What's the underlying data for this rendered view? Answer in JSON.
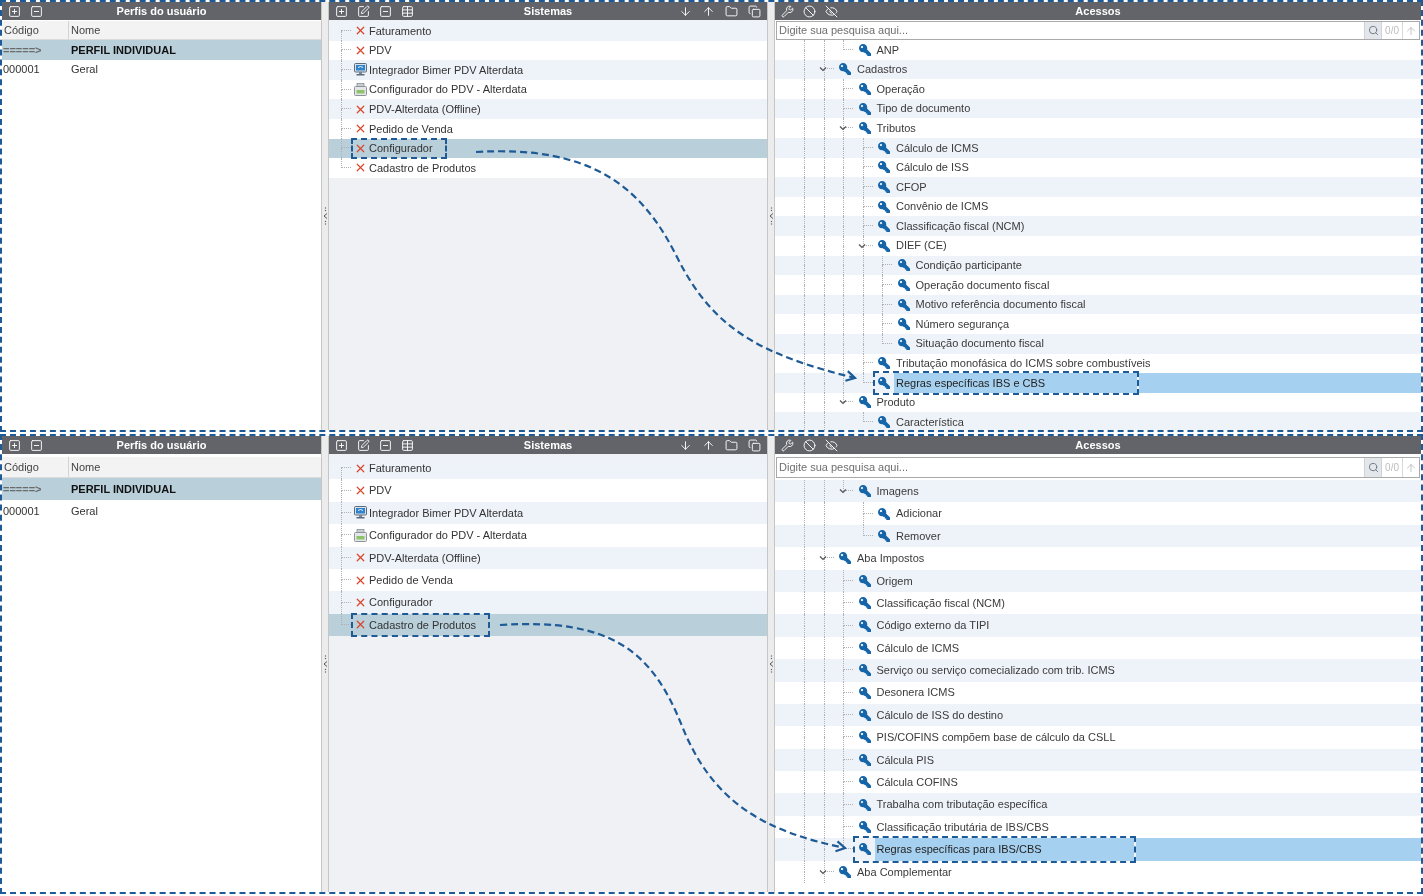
{
  "screens": [
    {
      "profiles": {
        "title": "Perfis do usuário",
        "columns": [
          "Código",
          "Nome"
        ],
        "rows": [
          {
            "code": "=====>",
            "name": "PERFIL INDIVIDUAL",
            "selected": true
          },
          {
            "code": "000001",
            "name": "Geral",
            "selected": false
          }
        ]
      },
      "systems": {
        "title": "Sistemas",
        "items": [
          {
            "label": "Faturamento",
            "kind": "denied",
            "selected": false
          },
          {
            "label": "PDV",
            "kind": "denied",
            "selected": false
          },
          {
            "label": "Integrador Bimer PDV Alterdata",
            "kind": "computer",
            "selected": false
          },
          {
            "label": "Configurador do PDV - Alterdata",
            "kind": "register",
            "selected": false
          },
          {
            "label": "PDV-Alterdata (Offline)",
            "kind": "denied",
            "selected": false
          },
          {
            "label": "Pedido de Venda",
            "kind": "denied",
            "selected": false
          },
          {
            "label": "Configurador",
            "kind": "denied",
            "selected": true
          },
          {
            "label": "Cadastro de Produtos",
            "kind": "denied",
            "selected": false
          }
        ]
      },
      "access": {
        "title": "Acessos",
        "search": {
          "placeholder": "Digite sua pesquisa aqui...",
          "counter": "0/0",
          "navigation_disabled": true
        },
        "tree": [
          {
            "children": [
              {
                "label": "ANP",
                "selected": false
              }
            ]
          },
          {
            "label": "Cadastros",
            "expanded": true,
            "selected": false,
            "children": [
              {
                "label": "Operação",
                "selected": false
              },
              {
                "label": "Tipo de documento",
                "selected": false
              },
              {
                "label": "Tributos",
                "expanded": true,
                "selected": false,
                "children": [
                  {
                    "label": "Cálculo de ICMS",
                    "selected": false
                  },
                  {
                    "label": "Cálculo de ISS",
                    "selected": false
                  },
                  {
                    "label": "CFOP",
                    "selected": false
                  },
                  {
                    "label": "Convênio de ICMS",
                    "selected": false
                  },
                  {
                    "label": "Classificação fiscal (NCM)",
                    "selected": false
                  },
                  {
                    "label": "DIEF (CE)",
                    "expanded": true,
                    "selected": false,
                    "children": [
                      {
                        "label": "Condição participante",
                        "selected": false
                      },
                      {
                        "label": "Operação documento fiscal",
                        "selected": false
                      },
                      {
                        "label": "Motivo referência documento fiscal",
                        "selected": false
                      },
                      {
                        "label": "Número segurança",
                        "selected": false
                      },
                      {
                        "label": "Situação documento fiscal",
                        "selected": false
                      }
                    ]
                  },
                  {
                    "label": "Tributação monofásica do ICMS sobre combustíveis",
                    "selected": false
                  },
                  {
                    "label": "Regras específicas IBS e CBS",
                    "selected": true
                  }
                ]
              },
              {
                "label": "Produto",
                "expanded": true,
                "selected": false,
                "children": [
                  {
                    "label": "Característica",
                    "selected": false
                  }
                ]
              }
            ]
          }
        ]
      }
    },
    {
      "profiles": {
        "title": "Perfis do usuário",
        "columns": [
          "Código",
          "Nome"
        ],
        "rows": [
          {
            "code": "=====>",
            "name": "PERFIL INDIVIDUAL",
            "selected": true
          },
          {
            "code": "000001",
            "name": "Geral",
            "selected": false
          }
        ]
      },
      "systems": {
        "title": "Sistemas",
        "items": [
          {
            "label": "Faturamento",
            "kind": "denied",
            "selected": false
          },
          {
            "label": "PDV",
            "kind": "denied",
            "selected": false
          },
          {
            "label": "Integrador Bimer PDV Alterdata",
            "kind": "computer",
            "selected": false
          },
          {
            "label": "Configurador do PDV - Alterdata",
            "kind": "register",
            "selected": false
          },
          {
            "label": "PDV-Alterdata (Offline)",
            "kind": "denied",
            "selected": false
          },
          {
            "label": "Pedido de Venda",
            "kind": "denied",
            "selected": false
          },
          {
            "label": "Configurador",
            "kind": "denied",
            "selected": false
          },
          {
            "label": "Cadastro de Produtos",
            "kind": "denied",
            "selected": true
          }
        ]
      },
      "access": {
        "title": "Acessos",
        "search": {
          "placeholder": "Digite sua pesquisa aqui...",
          "counter": "0/0",
          "navigation_disabled": true
        },
        "tree": [
          {
            "children": [
              {
                "label": "Imagens",
                "expanded": true,
                "selected": false,
                "children": [
                  {
                    "label": "Adicionar",
                    "selected": false
                  },
                  {
                    "label": "Remover",
                    "selected": false
                  }
                ]
              }
            ]
          },
          {
            "label": "Aba Impostos",
            "expanded": true,
            "selected": false,
            "children": [
              {
                "label": "Origem",
                "selected": false
              },
              {
                "label": "Classificação fiscal (NCM)",
                "selected": false
              },
              {
                "label": "Código externo da TIPI",
                "selected": false
              },
              {
                "label": "Cálculo de ICMS",
                "selected": false
              },
              {
                "label": "Serviço ou serviço comecializado com trib. ICMS",
                "selected": false
              },
              {
                "label": "Desonera ICMS",
                "selected": false
              },
              {
                "label": "Cálculo de ISS do destino",
                "selected": false
              },
              {
                "label": "PIS/COFINS compõem base de cálculo da CSLL",
                "selected": false
              },
              {
                "label": "Cálcula PIS",
                "selected": false
              },
              {
                "label": "Cálcula COFINS",
                "selected": false
              },
              {
                "label": "Trabalha com tributação específica",
                "selected": false
              },
              {
                "label": "Classificação tributária de IBS/CBS",
                "selected": false
              },
              {
                "label": "Regras específicas para IBS/CBS",
                "selected": true
              }
            ]
          },
          {
            "label": "Aba Complementar",
            "expanded": true,
            "selected": false
          }
        ]
      }
    }
  ]
}
